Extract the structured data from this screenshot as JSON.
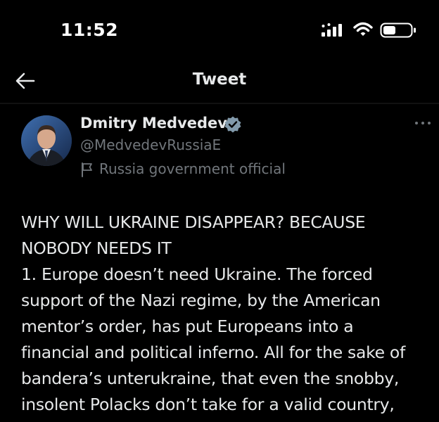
{
  "status_bar": {
    "time": "11:52",
    "icons": [
      "signal-icon",
      "wifi-icon",
      "battery-icon"
    ]
  },
  "header": {
    "title": "Tweet",
    "back_icon": "back-arrow-icon"
  },
  "author": {
    "name": "Dmitry Medvedev",
    "handle": "@MedvedevRussiaE",
    "label": "Russia government official",
    "verified_color": "#829aab",
    "label_icon": "flag-icon"
  },
  "tweet": {
    "text": "WHY WILL UKRAINE DISAPPEAR? BECAUSE\nNOBODY NEEDS IT\n1. Europe doesn’t need Ukraine. The forced\nsupport of the Nazi regime, by the American\nmentor’s order, has put Europeans into a\nfinancial and political inferno. All for the sake of\nbandera’s unterukraine, that even the snobby,\ninsolent Polacks don’t take for a valid country,"
  },
  "colors": {
    "background": "#000000",
    "text_primary": "#e7e9ea",
    "text_secondary": "#71767b"
  }
}
